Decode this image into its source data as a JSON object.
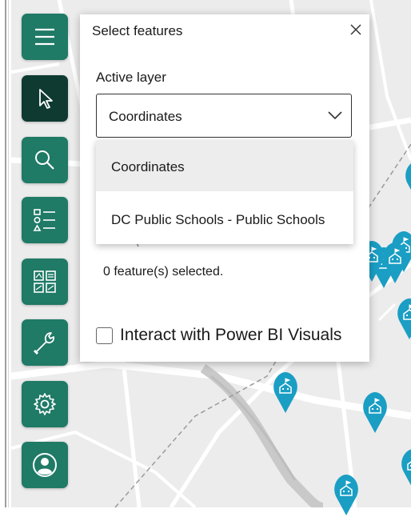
{
  "toolbar": {
    "buttons": [
      {
        "name": "menu",
        "icon": "hamburger-menu-icon"
      },
      {
        "name": "select",
        "icon": "cursor-arrow-icon",
        "active": true
      },
      {
        "name": "search",
        "icon": "search-icon"
      },
      {
        "name": "layers-list",
        "icon": "layer-list-icon"
      },
      {
        "name": "qr-analysis",
        "icon": "grid-analysis-icon"
      },
      {
        "name": "tools",
        "icon": "wrench-icon"
      },
      {
        "name": "settings",
        "icon": "gear-icon"
      },
      {
        "name": "account",
        "icon": "user-icon"
      }
    ]
  },
  "panel": {
    "title": "Select features",
    "active_layer_label": "Active layer",
    "selected_layer": "Coordinates",
    "selection_count": "0 feature(s) selected.",
    "interact_label": "Interact with Power BI Visuals",
    "interact_checked": false
  },
  "dropdown": {
    "options": [
      "Coordinates",
      "DC Public Schools - Public Schools"
    ],
    "highlighted_index": 0
  },
  "map": {
    "pin_icon": "school-pin-icon",
    "pin_color": "#1a9ec4",
    "accent": "#1f7a66"
  }
}
